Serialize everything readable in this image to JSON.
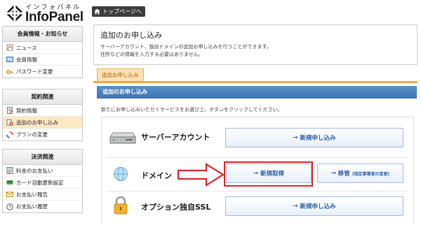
{
  "brand": {
    "sub": "インフォパネル",
    "main": "InfoPanel"
  },
  "top_button": "トップページへ",
  "sidebar": [
    {
      "header": "会員情報・お知らせ",
      "items": [
        {
          "label": "ニュース",
          "icon": "news-icon"
        },
        {
          "label": "会員情報",
          "icon": "member-icon"
        },
        {
          "label": "パスワード変更",
          "icon": "password-icon"
        }
      ]
    },
    {
      "header": "契約関連",
      "items": [
        {
          "label": "契約情報",
          "icon": "contract-icon"
        },
        {
          "label": "追加のお申し込み",
          "icon": "add-icon",
          "active": true
        },
        {
          "label": "プランの変更",
          "icon": "plan-change-icon"
        }
      ]
    },
    {
      "header": "決済関連",
      "items": [
        {
          "label": "料金のお支払い",
          "icon": "payment-icon"
        },
        {
          "label": "カード自動更新設定",
          "icon": "card-icon"
        },
        {
          "label": "お支払い報告",
          "icon": "report-icon"
        },
        {
          "label": "お支払い履歴",
          "icon": "history-icon"
        }
      ]
    }
  ],
  "panel": {
    "title": "追加のお申し込み",
    "desc1": "サーバーアカウント、独自ドメインの追加お申し込みを行うことができます。",
    "desc2": "住所などの情報を入力する必要はありません。"
  },
  "tab": "追加お申し込み",
  "section_title": "追加のお申し込み",
  "instruction": "新たにお申し込みいただくサービスをお選び上、ボタンをクリックしてください。",
  "services": [
    {
      "label": "サーバーアカウント",
      "buttons": [
        {
          "text": "新規申し込み"
        }
      ]
    },
    {
      "label": "ドメイン",
      "buttons": [
        {
          "text": "新規取得"
        },
        {
          "text": "移管",
          "note": "(指定事業者の変更)"
        }
      ]
    },
    {
      "label": "オプション独自SSL",
      "buttons": [
        {
          "text": "新規申し込み"
        }
      ]
    }
  ],
  "colors": {
    "accent_orange": "#f0a64a",
    "header_blue": "#3d74b2",
    "highlight_red": "#d8262c"
  }
}
